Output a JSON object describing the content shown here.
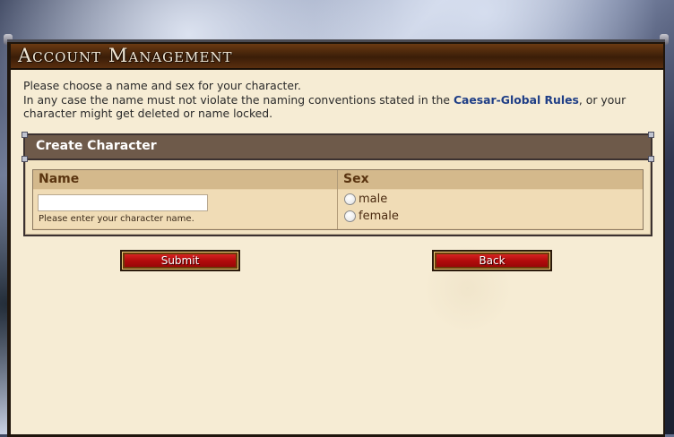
{
  "window": {
    "title": "Account Management"
  },
  "intro": {
    "line1": "Please choose a name and sex for your character.",
    "line2_before": "In any case the name must not violate the naming conventions stated in the ",
    "rules_link": "Caesar-Global Rules",
    "line2_after": ", or your",
    "line3": "character might get deleted or name locked."
  },
  "panel": {
    "title": "Create Character",
    "columns": {
      "name": "Name",
      "sex": "Sex"
    },
    "name_input": {
      "value": "",
      "placeholder": ""
    },
    "name_hint": "Please enter your character name.",
    "sex_options": [
      "male",
      "female"
    ],
    "sex_selected": null
  },
  "buttons": {
    "submit": "Submit",
    "back": "Back"
  },
  "colors": {
    "button_red": "#c81414",
    "link_blue": "#1f3e86",
    "panel_header": "#6e5a4a",
    "content_bg": "#f6ecd4"
  }
}
